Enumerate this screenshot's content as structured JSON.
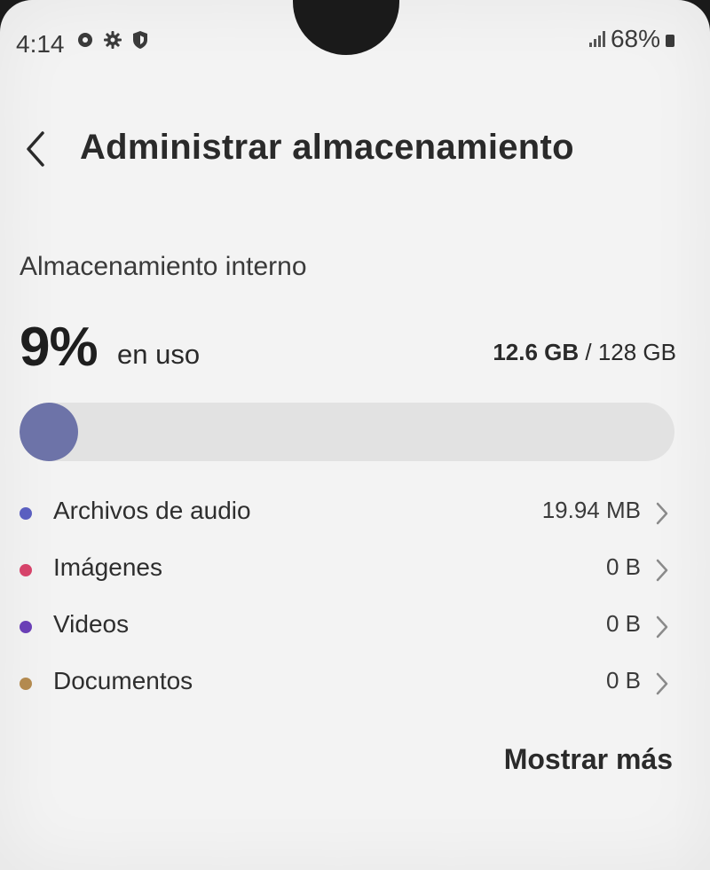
{
  "status_bar": {
    "time": "4:14",
    "battery_percent": "68%",
    "icons_left": [
      "location-icon",
      "settings-icon",
      "shield-icon"
    ],
    "icons_right": [
      "signal-icon",
      "battery-icon"
    ]
  },
  "header": {
    "title": "Administrar almacenamiento",
    "back_icon": "chevron-left-icon"
  },
  "storage": {
    "section_label": "Almacenamiento interno",
    "used_percent_label": "9%",
    "used_text": "en uso",
    "used_size": "12.6 GB",
    "separator": " / ",
    "total_size": "128 GB",
    "used_fraction": 0.09,
    "bar_color": "#6d73a8"
  },
  "categories": [
    {
      "label": "Archivos de audio",
      "value": "19.94 MB",
      "color": "#5a5fc0"
    },
    {
      "label": "Imágenes",
      "value": "0 B",
      "color": "#d6436a"
    },
    {
      "label": "Videos",
      "value": "0 B",
      "color": "#6a3fb6"
    },
    {
      "label": "Documentos",
      "value": "0 B",
      "color": "#b38a4f"
    }
  ],
  "actions": {
    "show_more": "Mostrar más"
  }
}
